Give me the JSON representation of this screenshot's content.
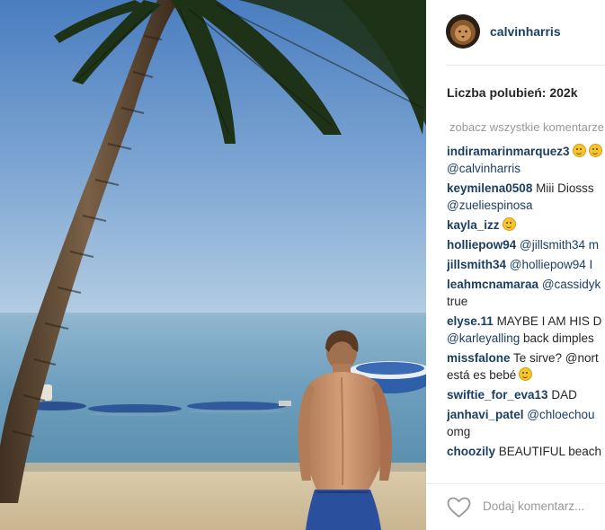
{
  "post": {
    "username": "calvinharris",
    "likes": "Liczba polubień: 202k",
    "view_all": "zobacz wszystkie komentarze",
    "add_comment_placeholder": "Dodaj komentarz...",
    "comments": [
      {
        "user": "indiramarinmarquez3",
        "text": "",
        "line2": "@calvinharris",
        "emoji": 2
      },
      {
        "user": "keymilena0508",
        "text": "Miii Diosss",
        "line2": "@zueliespinosa",
        "emoji": 0
      },
      {
        "user": "kayla_izz",
        "text": "",
        "line2": "",
        "emoji": 1
      },
      {
        "user": "holliepow94",
        "text": "@jillsmith34 m",
        "line2": "",
        "emoji": 0
      },
      {
        "user": "jillsmith34",
        "text": "@holliepow94 I",
        "line2": "",
        "emoji": 0
      },
      {
        "user": "leahmcnamaraa",
        "text": "@cassidyk",
        "line2": "true",
        "emoji": 0
      },
      {
        "user": "elyse.11",
        "text": "MAYBE I AM HIS D",
        "line2": "@karleyalling back dimples",
        "emoji": 0
      },
      {
        "user": "missfalone",
        "text": "Te sirve? @nort",
        "line2": "está es bebé",
        "emoji": 0,
        "emoji2": 1
      },
      {
        "user": "swiftie_for_eva13",
        "text": "DAD",
        "line2": "",
        "emoji": 0
      },
      {
        "user": "janhavi_patel",
        "text": "@chloechou",
        "line2": "omg",
        "emoji": 0
      },
      {
        "user": "choozily",
        "text": "BEAUTIFUL beach",
        "line2": "",
        "emoji": 0
      }
    ]
  },
  "colors": {
    "username": "#1b3f63",
    "text": "#262626",
    "muted": "#999999",
    "sky_top": "#4d7fc1",
    "sky_bottom": "#a9c5df",
    "sea": "#5d93b5",
    "sand": "#d8c8aa"
  },
  "icons": [
    "heart-icon",
    "avatar-lion"
  ]
}
